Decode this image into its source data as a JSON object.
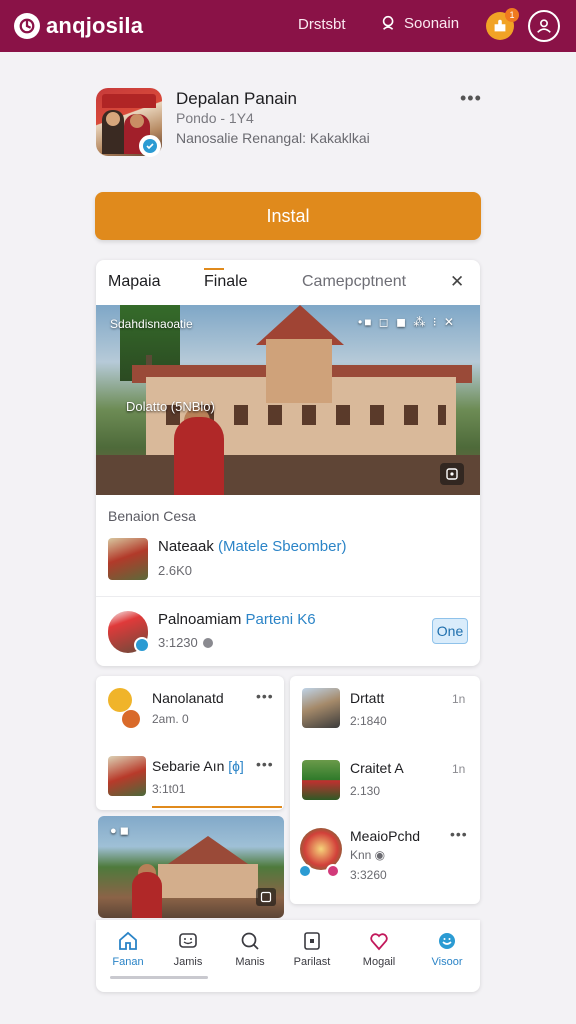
{
  "topbar": {
    "brand": "anqjosila",
    "link_1": "Drstsbt",
    "search_label": "Soonain",
    "notif_count": "1",
    "bg_color": "#8a1247"
  },
  "app": {
    "title": "Depalan Panain",
    "meta": "Pondo - 1Y4",
    "developer": "Nanosalie Renangal: Kakaklkai",
    "install_label": "Instal",
    "accent_color": "#e08a1c"
  },
  "tabs": [
    {
      "label": "Mapaia"
    },
    {
      "label": "Finale"
    },
    {
      "label": "Camepcptnent"
    }
  ],
  "hero": {
    "top_label": "Sdahdisnaoatie",
    "controls": "•■ ◻ ◼ ⁂ ⁝ ✕",
    "sub_label": "Dolatto (5NBlo)"
  },
  "section": {
    "label": "Benaion Cesa"
  },
  "rows": [
    {
      "title": "Nateaak",
      "highlight": "(Matele Sbeomber)",
      "sub": "2.6K0"
    },
    {
      "title": "Palnoamiam",
      "highlight": "Parteni K6",
      "sub": "3:1230",
      "action": "One"
    }
  ],
  "left_list": [
    {
      "name": "Nanolanatd",
      "meta": "2am. 0"
    },
    {
      "name": "Sebarie Aın",
      "highlight": "[ɸ]",
      "meta": "3:1t01"
    }
  ],
  "right_list": [
    {
      "name": "Drtatt",
      "meta": "2:1840",
      "side": "1n"
    },
    {
      "name": "Craitet A",
      "meta": "2.130",
      "side": "1n"
    },
    {
      "name": "MeaioPchd",
      "meta": "Knn ◉",
      "meta2": "3:3260"
    }
  ],
  "nav": [
    {
      "label": "Fanan",
      "icon": "home-icon",
      "active": true
    },
    {
      "label": "Jamis",
      "icon": "chat-icon"
    },
    {
      "label": "Manis",
      "icon": "search-icon"
    },
    {
      "label": "Parilast",
      "icon": "square-icon"
    },
    {
      "label": "Mogail",
      "icon": "heart-icon"
    },
    {
      "label": "Visoor",
      "icon": "smile-icon",
      "active": true
    }
  ]
}
